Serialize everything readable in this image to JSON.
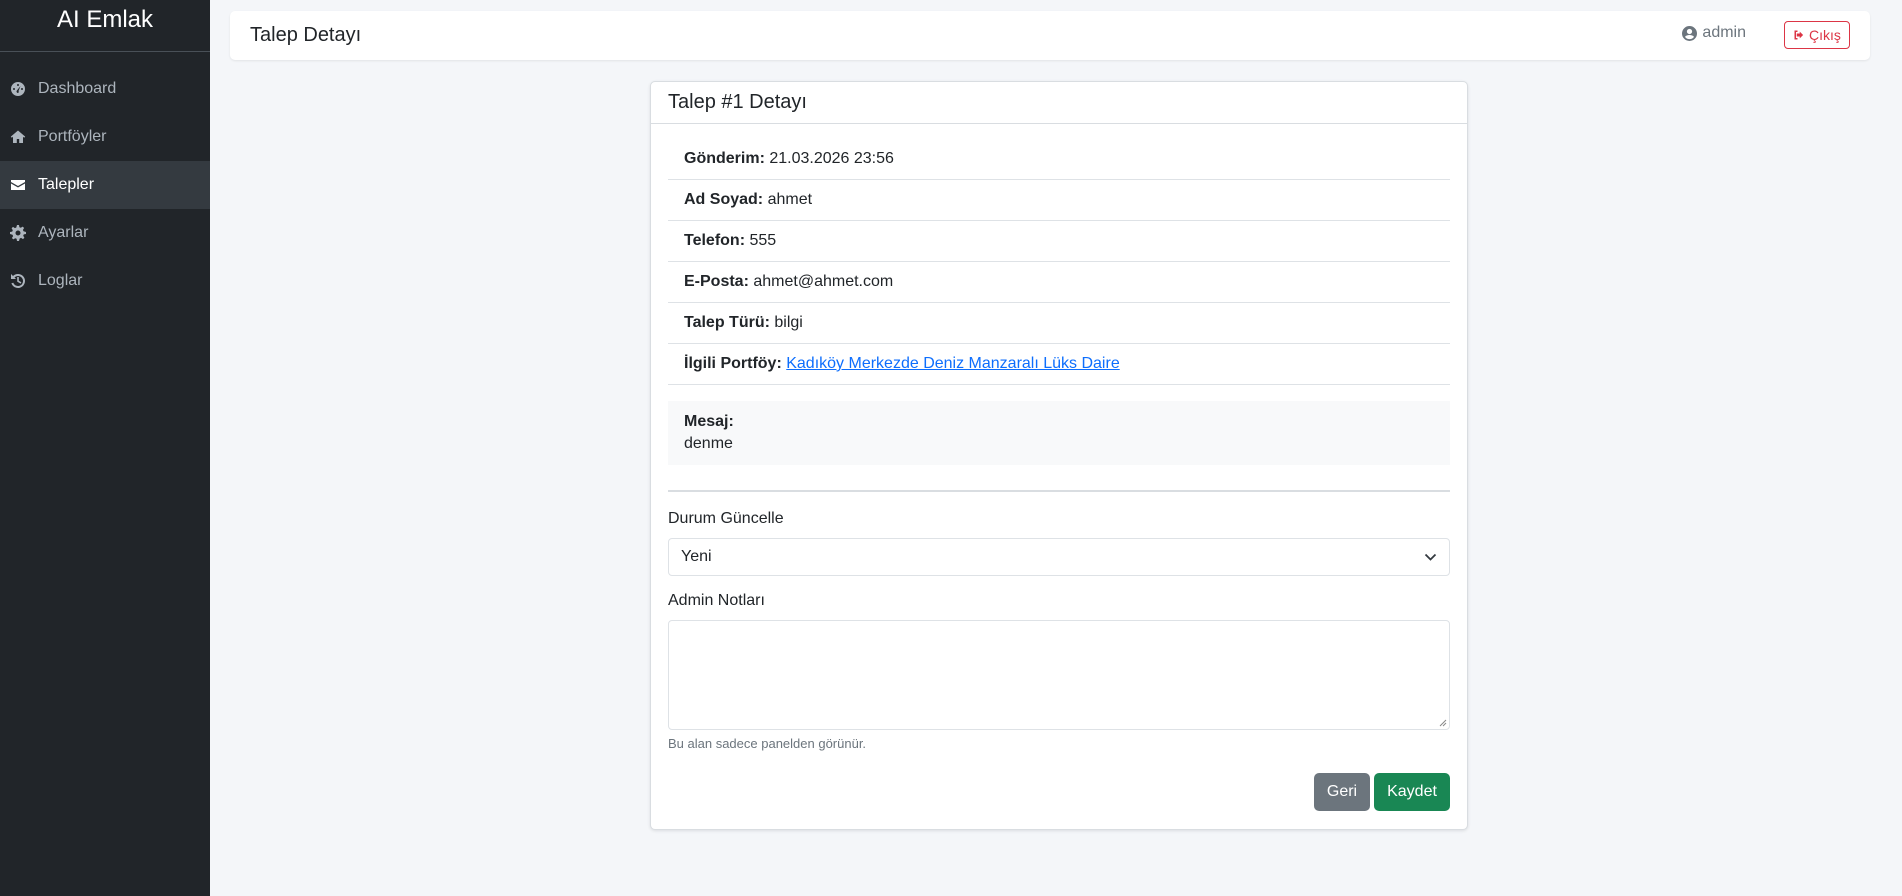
{
  "sidebar": {
    "brand": "AI Emlak",
    "items": [
      {
        "label": "Dashboard",
        "icon": "dashboard-icon",
        "active": false
      },
      {
        "label": "Portföyler",
        "icon": "home-icon",
        "active": false
      },
      {
        "label": "Talepler",
        "icon": "envelope-icon",
        "active": true
      },
      {
        "label": "Ayarlar",
        "icon": "gear-icon",
        "active": false
      },
      {
        "label": "Loglar",
        "icon": "history-icon",
        "active": false
      }
    ]
  },
  "header": {
    "title": "Talep Detayı",
    "user": "admin",
    "logout_label": "Çıkış"
  },
  "card": {
    "title": "Talep #1 Detayı",
    "fields": [
      {
        "label": "Gönderim:",
        "value": "21.03.2026 23:56"
      },
      {
        "label": "Ad Soyad:",
        "value": "ahmet"
      },
      {
        "label": "Telefon:",
        "value": "555"
      },
      {
        "label": "E-Posta:",
        "value": "ahmet@ahmet.com"
      },
      {
        "label": "Talep Türü:",
        "value": "bilgi"
      },
      {
        "label": "İlgili Portföy:",
        "value": "Kadıköy Merkezde Deniz Manzaralı Lüks Daire"
      }
    ],
    "message": {
      "label": "Mesaj:",
      "value": "denme"
    },
    "status": {
      "label": "Durum Güncelle",
      "selected": "Yeni"
    },
    "notes": {
      "label": "Admin Notları",
      "value": "",
      "help": "Bu alan sadece panelden görünür."
    },
    "buttons": {
      "back": "Geri",
      "save": "Kaydet"
    }
  },
  "colors": {
    "sidebar_bg": "#212529",
    "active_bg": "#343a40",
    "link": "#0d6efd",
    "danger": "#dc3545",
    "success": "#198754",
    "secondary": "#6c757d"
  }
}
